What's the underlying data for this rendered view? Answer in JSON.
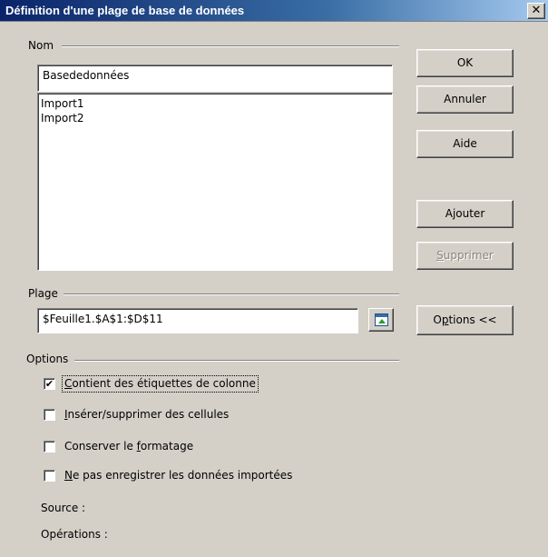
{
  "window": {
    "title": "Définition d'une plage de base de données",
    "close_glyph": "✕"
  },
  "nom": {
    "group_label": "Nom",
    "value": "Basededonnées",
    "list": [
      "Import1",
      "Import2"
    ]
  },
  "plage": {
    "group_label": "Plage",
    "value": "$Feuille1.$A$1:$D$11"
  },
  "options": {
    "group_label": "Options",
    "checkboxes": [
      {
        "prefix": "",
        "mnemonic": "C",
        "suffix": "ontient des étiquettes de colonne",
        "checked": true
      },
      {
        "prefix": "",
        "mnemonic": "I",
        "suffix": "nsérer/supprimer des cellules",
        "checked": false
      },
      {
        "prefix": "Conserver le ",
        "mnemonic": "f",
        "suffix": "ormatage",
        "checked": false
      },
      {
        "prefix": "",
        "mnemonic": "N",
        "suffix": "e pas enregistrer les données importées",
        "checked": false
      }
    ],
    "source_label": "Source :",
    "operations_label": "Opérations :"
  },
  "buttons": {
    "ok": "OK",
    "annuler": "Annuler",
    "aide": "Aide",
    "ajouter": "Ajouter",
    "supprimer_mnemonic": "S",
    "supprimer_rest": "upprimer",
    "options_prefix": "O",
    "options_mnemonic": "p",
    "options_rest": "tions <<"
  },
  "icons": {
    "shrink": "shrink-range-icon",
    "check": "✔"
  }
}
